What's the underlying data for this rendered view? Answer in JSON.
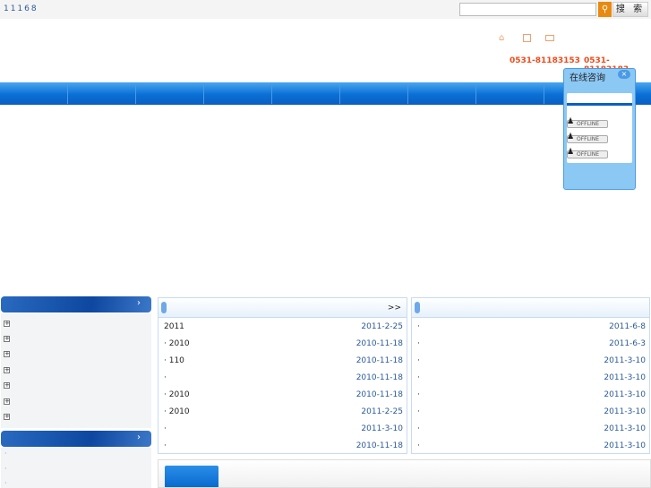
{
  "header": {
    "top_text": "11168",
    "search_placeholder": "",
    "search_button": "搜 索",
    "phones": [
      "0531-81183153",
      "0531-81183183"
    ],
    "icons": [
      "home-icon",
      "calendar-icon",
      "mail-icon"
    ]
  },
  "consult": {
    "title": "在线咨询",
    "close": "×",
    "status": [
      "OFFLINE",
      "OFFLINE",
      "OFFLINE"
    ]
  },
  "panel_left": {
    "more": ">>",
    "rows": [
      {
        "t": "2011",
        "d": "2011-2-25"
      },
      {
        "t": "·   2010",
        "d": "2010-11-18"
      },
      {
        "t": "·    110",
        "d": "2010-11-18"
      },
      {
        "t": "·",
        "d": "2010-11-18"
      },
      {
        "t": "·   2010",
        "d": "2010-11-18"
      },
      {
        "t": "·    2010",
        "d": "2011-2-25"
      },
      {
        "t": "·",
        "d": "2011-3-10"
      },
      {
        "t": "·",
        "d": "2010-11-18"
      }
    ]
  },
  "panel_right": {
    "more": "",
    "rows": [
      {
        "t": "·",
        "d": "2011-6-8"
      },
      {
        "t": "·",
        "d": "2011-6-3"
      },
      {
        "t": "·",
        "d": "2011-3-10"
      },
      {
        "t": "·",
        "d": "2011-3-10"
      },
      {
        "t": "·",
        "d": "2011-3-10"
      },
      {
        "t": "·",
        "d": "2011-3-10"
      },
      {
        "t": "·",
        "d": "2011-3-10"
      },
      {
        "t": "·",
        "d": "2011-3-10"
      }
    ]
  },
  "sidebar": {
    "arrow": "›",
    "plus": "+",
    "dot": "·"
  }
}
